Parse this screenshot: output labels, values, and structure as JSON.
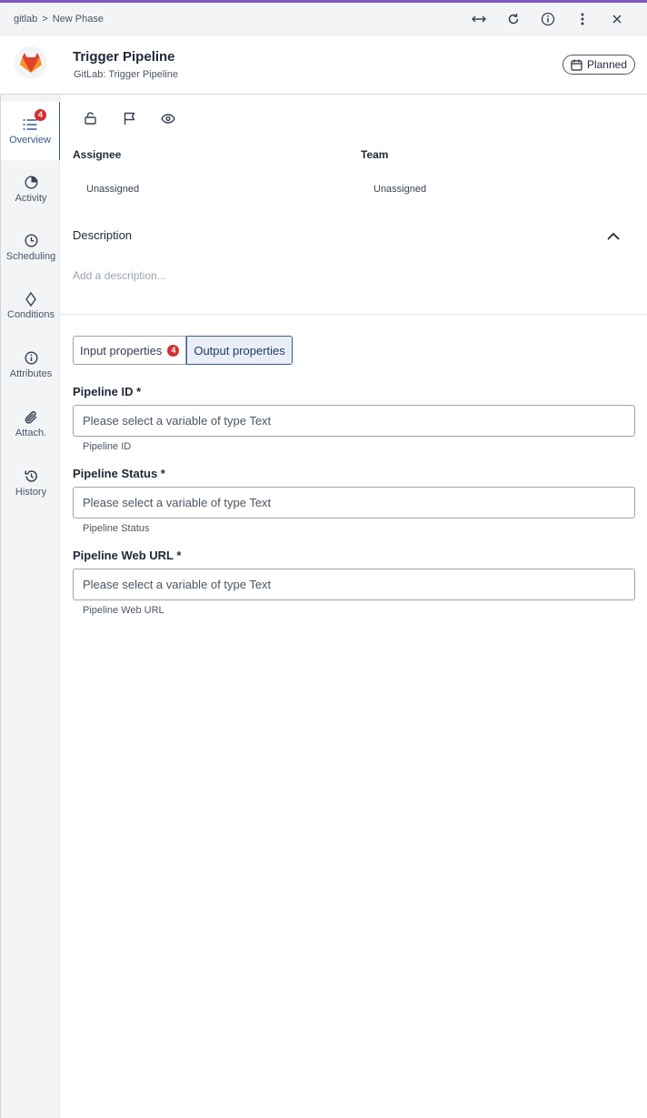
{
  "breadcrumb": {
    "items": [
      "gitlab",
      "New Phase"
    ],
    "separator": ">"
  },
  "header": {
    "title": "Trigger Pipeline",
    "subtitle": "GitLab: Trigger Pipeline",
    "status": "Planned"
  },
  "sidebar": {
    "items": [
      {
        "label": "Overview",
        "icon": "list-icon",
        "badge": "4",
        "active": true
      },
      {
        "label": "Activity",
        "icon": "pie-chart-icon"
      },
      {
        "label": "Scheduling",
        "icon": "clock-icon"
      },
      {
        "label": "Conditions",
        "icon": "diamond-icon"
      },
      {
        "label": "Attributes",
        "icon": "info-icon"
      },
      {
        "label": "Attach.",
        "icon": "paperclip-icon"
      },
      {
        "label": "History",
        "icon": "history-icon"
      }
    ]
  },
  "assignment": {
    "assignee_label": "Assignee",
    "assignee_value": "Unassigned",
    "team_label": "Team",
    "team_value": "Unassigned"
  },
  "description": {
    "title": "Description",
    "placeholder": "Add a description..."
  },
  "tabs": {
    "input_label": "Input properties",
    "input_badge": "4",
    "output_label": "Output properties"
  },
  "properties": [
    {
      "label": "Pipeline ID *",
      "placeholder": "Please select a variable of type Text",
      "help": "Pipeline ID"
    },
    {
      "label": "Pipeline Status *",
      "placeholder": "Please select a variable of type Text",
      "help": "Pipeline Status"
    },
    {
      "label": "Pipeline Web URL *",
      "placeholder": "Please select a variable of type Text",
      "help": "Pipeline Web URL"
    }
  ],
  "colors": {
    "accent": "#3a5a8c",
    "badge": "#d32f2f",
    "top_line": "#7e57c2"
  }
}
